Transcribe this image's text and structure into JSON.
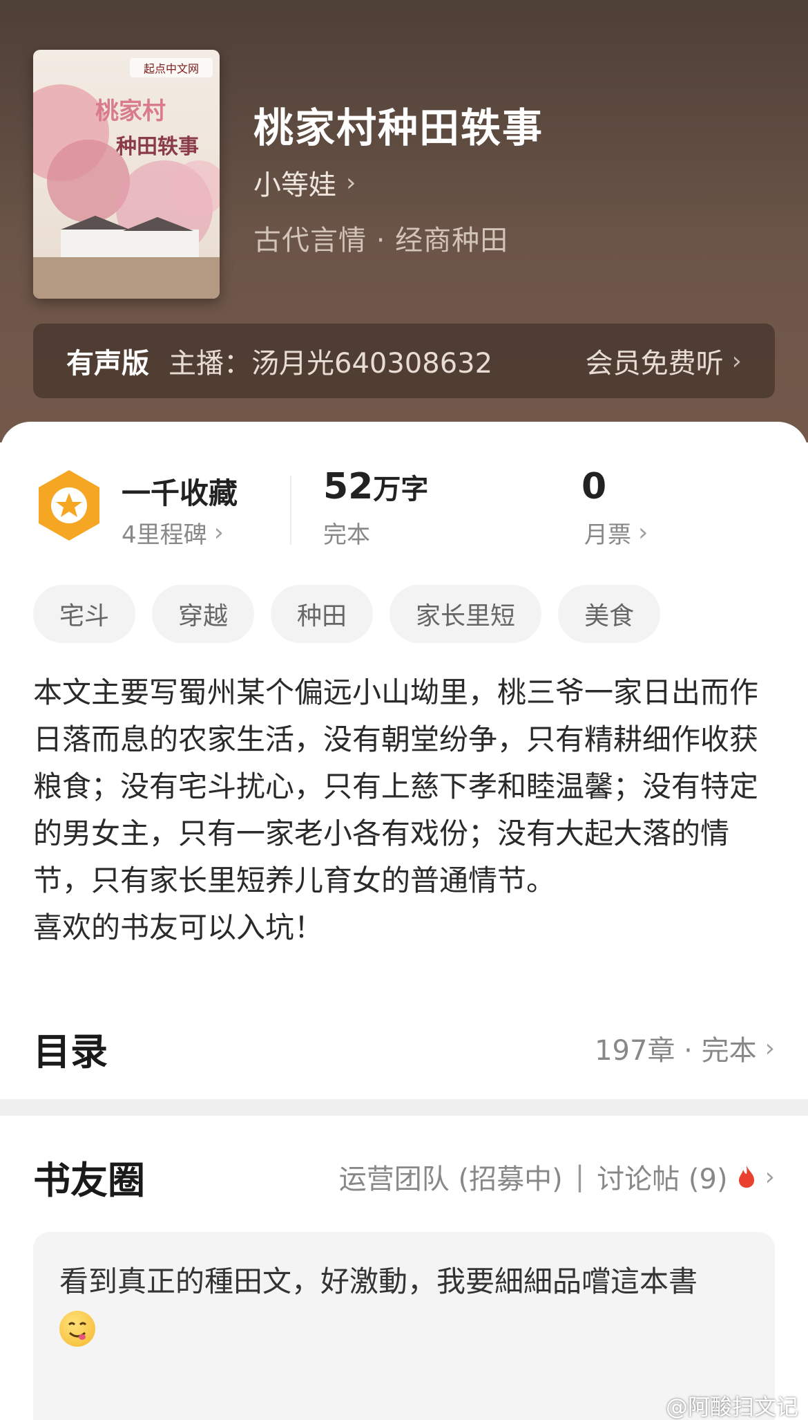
{
  "book": {
    "title": "桃家村种田轶事",
    "author": "小等娃",
    "genre": "古代言情 · 经商种田",
    "cover": {
      "brand_text": "起点中文网",
      "title_line1": "桃家村",
      "title_line2": "种田轶事"
    }
  },
  "audio": {
    "label": "有声版",
    "host": "主播：汤月光640308632",
    "cta": "会员免费听"
  },
  "stats": {
    "milestone_title": "一千收藏",
    "milestone_sub": "4里程碑",
    "word_count_num": "52",
    "word_count_unit": "万字",
    "status": "完本",
    "monthly_ticket_num": "0",
    "monthly_ticket_label": "月票"
  },
  "tags": [
    "宅斗",
    "穿越",
    "种田",
    "家长里短",
    "美食"
  ],
  "description": [
    "本文主要写蜀州某个偏远小山坳里，桃三爷一家日出而作日落而息的农家生活，没有朝堂纷争，只有精耕细作收获粮食；没有宅斗扰心，只有上慈下孝和睦温馨；没有特定的男女主，只有一家老小各有戏份；没有大起大落的情节，只有家长里短养儿育女的普通情节。",
    "喜欢的书友可以入坑！"
  ],
  "toc": {
    "title": "目录",
    "info": "197章 · 完本"
  },
  "circle": {
    "title": "书友圈",
    "ops_team": "运营团队 (招募中)",
    "divider": "|",
    "discussion": "讨论帖 (9)"
  },
  "post": {
    "text": "看到真正的種田文，好激動，我要細細品嚐這本書"
  },
  "watermark": "@阿酸扫文记",
  "colors": {
    "header_bg": "#5d4a3f",
    "badge": "#f5a623",
    "hot": "#e8412f"
  }
}
